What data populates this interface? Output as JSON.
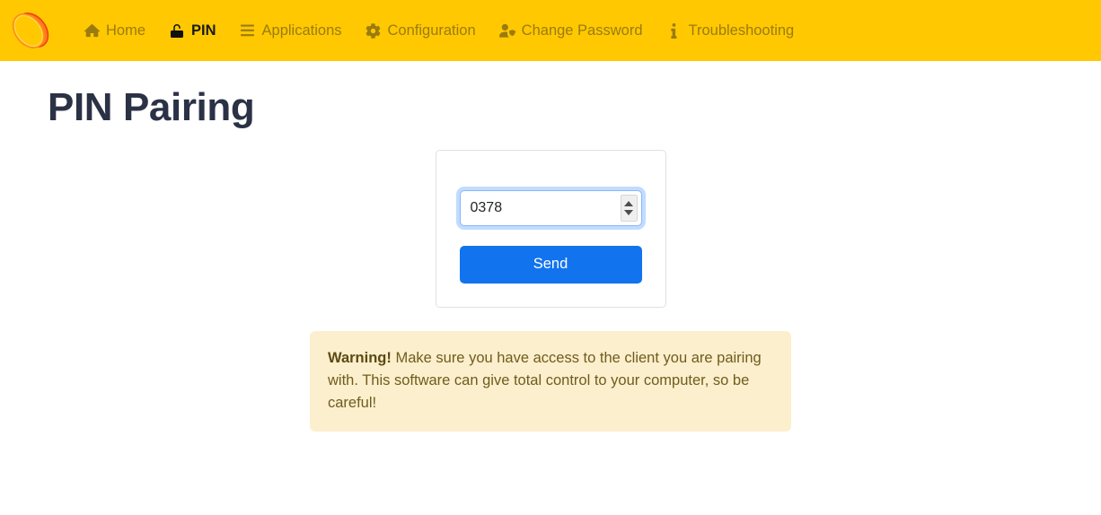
{
  "navbar": {
    "background_color": "#ffc800",
    "brand": {
      "icon": "ellipse-logo",
      "colors": {
        "fill": "#ffd400",
        "shadow": "#f26522",
        "outline": "#ff9f1c"
      }
    },
    "items": [
      {
        "label": "Home",
        "icon": "home-icon",
        "name": "nav-item-home",
        "active": false
      },
      {
        "label": "PIN",
        "icon": "unlock-icon",
        "name": "nav-item-pin",
        "active": true
      },
      {
        "label": "Applications",
        "icon": "list-icon",
        "name": "nav-item-applications",
        "active": false
      },
      {
        "label": "Configuration",
        "icon": "gear-icon",
        "name": "nav-item-configuration",
        "active": false
      },
      {
        "label": "Change Password",
        "icon": "user-shield-icon",
        "name": "nav-item-change-password",
        "active": false
      },
      {
        "label": "Troubleshooting",
        "icon": "info-icon",
        "name": "nav-item-troubleshooting",
        "active": false
      }
    ]
  },
  "page": {
    "title": "PIN Pairing",
    "title_color": "#2b3245"
  },
  "card": {
    "pin_input": {
      "value": "0378",
      "placeholder": "",
      "type": "number",
      "focused": true,
      "focus_ring_color": "#86b7fe"
    },
    "send_button": {
      "label": "Send",
      "color": "#1273ef",
      "text_color": "#ffffff"
    }
  },
  "warning": {
    "strong": "Warning!",
    "text": " Make sure you have access to the client you are pairing with. This software can give total control to your computer, so be careful!",
    "background_color": "#fcefcd",
    "text_color": "#705c1d"
  }
}
